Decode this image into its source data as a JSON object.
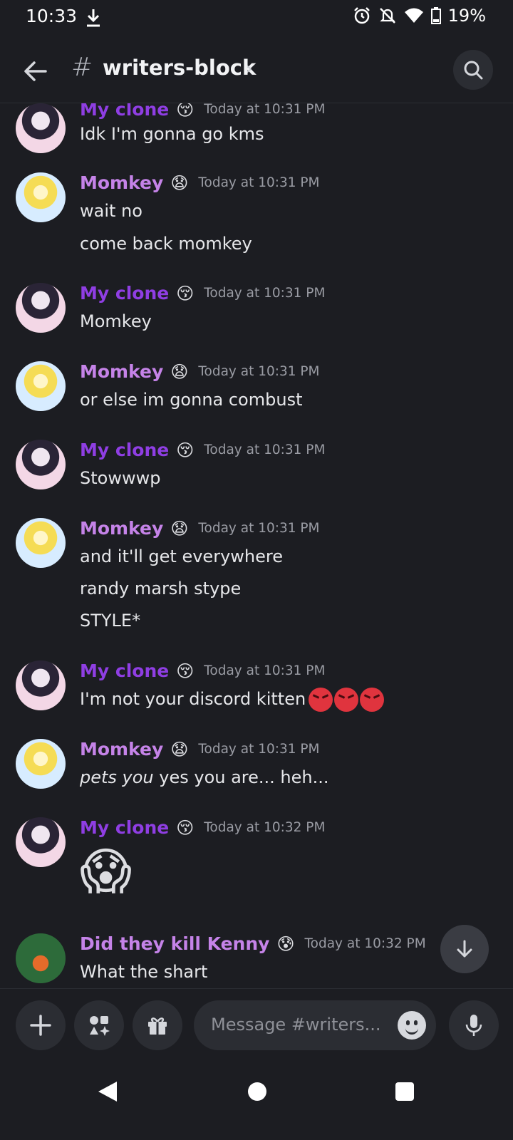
{
  "status_bar": {
    "time": "10:33",
    "battery": "19%"
  },
  "header": {
    "hash": "#",
    "channel": "writers-block",
    "chevron": "›"
  },
  "messages": [
    {
      "author": "My clone",
      "emoji": "😚",
      "time": "Today at 10:31 PM",
      "lines": [
        "Idk I'm gonna go kms"
      ]
    },
    {
      "author": "Momkey",
      "emoji": "😧",
      "time": "Today at 10:31 PM",
      "lines": [
        "wait no",
        "come back momkey"
      ]
    },
    {
      "author": "My clone",
      "emoji": "😚",
      "time": "Today at 10:31 PM",
      "lines": [
        "Momkey"
      ]
    },
    {
      "author": "Momkey",
      "emoji": "😧",
      "time": "Today at 10:31 PM",
      "lines": [
        "or else im gonna combust"
      ]
    },
    {
      "author": "My clone",
      "emoji": "😚",
      "time": "Today at 10:31 PM",
      "lines": [
        "Stowwwp"
      ]
    },
    {
      "author": "Momkey",
      "emoji": "😧",
      "time": "Today at 10:31 PM",
      "lines": [
        "and it'll get everywhere",
        "randy marsh stype",
        "STYLE*"
      ]
    },
    {
      "author": "My clone",
      "emoji": "😚",
      "time": "Today at 10:31 PM",
      "lines": [
        "I'm not your discord kitten"
      ]
    },
    {
      "author": "Momkey",
      "emoji": "😧",
      "time": "Today at 10:31 PM",
      "lines_italic": "pets you",
      "lines_rest": " yes you are... heh..."
    },
    {
      "author": "My clone",
      "emoji": "😚",
      "time": "Today at 10:32 PM",
      "big_emoji": "😱"
    },
    {
      "author": "Did they kill Kenny",
      "emoji": "😰",
      "time": "Today at 10:32 PM",
      "lines": [
        "What the shart"
      ]
    }
  ],
  "composer": {
    "placeholder": "Message #writers..."
  },
  "colors": {
    "background": "#1c1d22",
    "clone_name": "#8f3ee3",
    "momkey_name": "#c583e8"
  }
}
